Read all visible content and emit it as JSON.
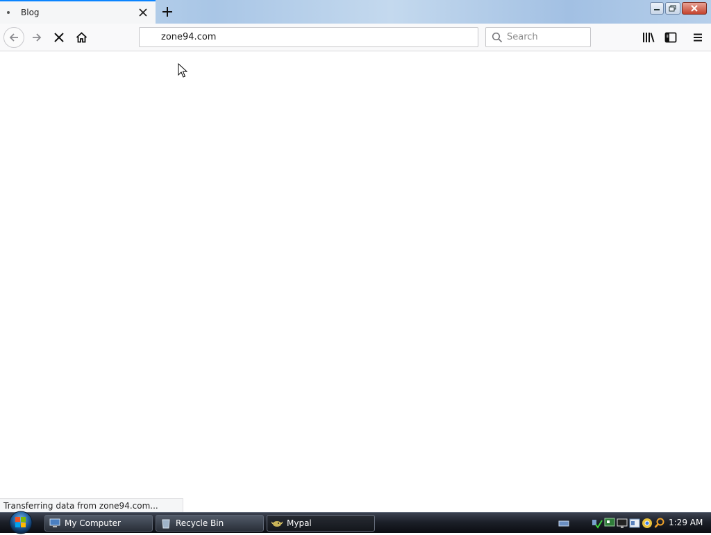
{
  "browser": {
    "tab": {
      "title": "Blog"
    },
    "url": "zone94.com",
    "search_placeholder": "Search",
    "status_text": "Transferring data from zone94.com..."
  },
  "taskbar": {
    "items": [
      {
        "label": "My Computer",
        "icon": "computer-icon",
        "active": false
      },
      {
        "label": "Recycle Bin",
        "icon": "recycle-bin-icon",
        "active": false
      },
      {
        "label": "Mypal",
        "icon": "mypal-icon",
        "active": true
      }
    ],
    "tray_icons": [
      "keyboard-icon",
      "network-check-icon",
      "monitor-icon",
      "display-icon",
      "folder-icon",
      "chrome-icon",
      "search-icon"
    ],
    "clock": "1:29 AM"
  },
  "colors": {
    "tab_accent": "#0a84ff",
    "taskbar": "#1c2029",
    "window_close": "#c4432d"
  }
}
